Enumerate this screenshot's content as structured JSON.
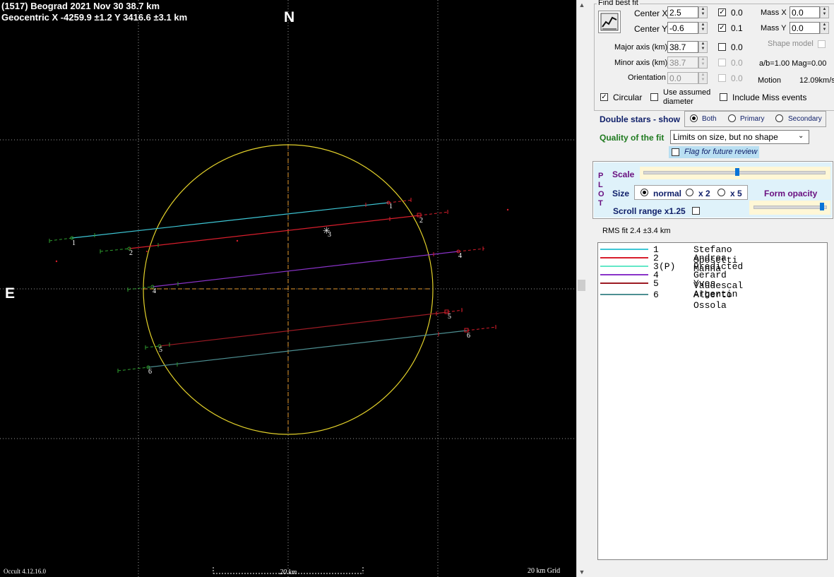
{
  "plot": {
    "title_line1": "(1517) Beograd  2021 Nov 30   38.7 km",
    "title_line2": "Geocentric X  -4259.9 ±1.2  Y 3416.6 ±3.1 km",
    "north_label": "N",
    "east_label": "E",
    "version": "Occult 4.12.16.0",
    "scale_label": "20 km",
    "grid_label": "20 km Grid",
    "chord_labels": [
      "1",
      "2",
      "3",
      "4",
      "5",
      "6"
    ]
  },
  "panel": {
    "find_best_fit_label": "Find best fit",
    "center_x_label": "Center X",
    "center_x_value": "2.5",
    "center_x_step": "0.0",
    "center_y_label": "Center Y",
    "center_y_value": "-0.6",
    "center_y_step": "0.1",
    "mass_x_label": "Mass X",
    "mass_x_value": "0.0",
    "mass_y_label": "Mass Y",
    "mass_y_value": "0.0",
    "shape_model_label": "Shape model",
    "major_axis_label": "Major axis (km)",
    "major_axis_value": "38.7",
    "major_axis_step": "0.0",
    "minor_axis_label": "Minor axis (km)",
    "minor_axis_value": "38.7",
    "minor_axis_step": "0.0",
    "ab_ratio": "a/b=1.00  Mag=0.00",
    "orientation_label": "Orientation",
    "orientation_value": "0.0",
    "orientation_step": "0.0",
    "motion_label": "Motion",
    "motion_value": "12.09km/s",
    "circular_label": "Circular",
    "assumed_diameter_label_1": "Use assumed",
    "assumed_diameter_label_2": "diameter",
    "include_miss_label": "Include Miss events",
    "double_stars_label": "Double stars - show",
    "double_options": [
      "Both",
      "Primary",
      "Secondary"
    ],
    "quality_label": "Quality of the fit",
    "quality_value": "Limits on size, but no shape",
    "flag_label": "Flag for future review",
    "plot_letters": [
      "P",
      "L",
      "O",
      "T"
    ],
    "scale_label": "Scale",
    "size_label": "Size",
    "size_options": [
      "normal",
      "x 2",
      "x 5"
    ],
    "form_opacity_label": "Form opacity",
    "scroll_range_label": "Scroll range x1.25",
    "rms_label": "RMS fit 2.4 ±3.4 km",
    "scale_slider_fraction": 0.52,
    "opacity_slider_fraction": 0.98
  },
  "legend": [
    {
      "num": "1",
      "tag": "",
      "name": "Stefano Sposetti",
      "color": "#3ec7d6"
    },
    {
      "num": "2",
      "tag": "",
      "name": "Andrea Manna",
      "color": "#d81e2c"
    },
    {
      "num": "3",
      "tag": "(P)",
      "name": "Predicted",
      "color": "#63e8c7"
    },
    {
      "num": "4",
      "tag": "",
      "name": "Gerard Vaudescal",
      "color": "#8a33c9"
    },
    {
      "num": "5",
      "tag": "",
      "name": "Yves Argentin",
      "color": "#9c1b24"
    },
    {
      "num": "6",
      "tag": "",
      "name": "Alberto Ossola",
      "color": "#4d8f92"
    }
  ],
  "colors": {
    "limb": "#e3d12a",
    "axis": "#e69a2e",
    "grid": "#9a9a9a",
    "chord_ends": "#2e9c2e"
  }
}
